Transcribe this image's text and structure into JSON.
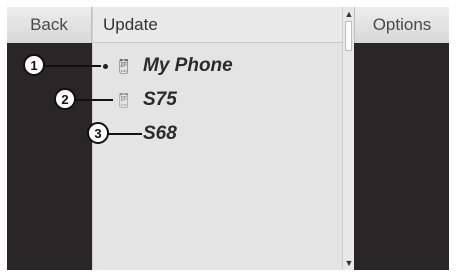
{
  "nav": {
    "back_label": "Back",
    "options_label": "Options"
  },
  "list": {
    "title": "Update",
    "items": [
      {
        "name": "My Phone",
        "selected": true,
        "icon": "mobile-phone-icon"
      },
      {
        "name": "S75",
        "selected": false,
        "icon": "mobile-phone-icon"
      },
      {
        "name": "S68",
        "selected": false,
        "icon": ""
      }
    ]
  },
  "callouts": [
    "1",
    "2",
    "3"
  ],
  "colors": {
    "panel_dark": "#2a2627",
    "list_bg": "#e4e4e4",
    "button_bg": "#e0e0e0"
  }
}
